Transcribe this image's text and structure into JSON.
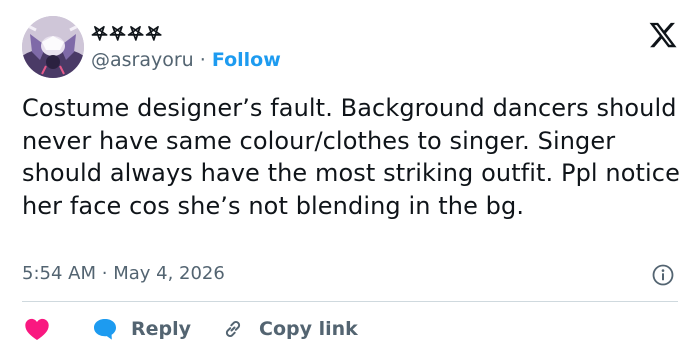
{
  "user": {
    "display_name": "𖤐𖤐𖤐𖤐",
    "handle": "@asrayoru",
    "separator": "·",
    "follow_label": "Follow"
  },
  "tweet": {
    "text": "Costume designer’s fault. Background dancers should never have same colour/clothes to singer. Singer should always have the most striking outfit. Ppl notice her face cos she’s not blending in the bg.",
    "time": "5:54 AM",
    "separator": "·",
    "date": "May 4, 2026"
  },
  "actions": {
    "reply_label": "Reply",
    "copy_link_label": "Copy link"
  },
  "colors": {
    "accent": "#1d9bf0",
    "like": "#f91880",
    "secondary_text": "#536471",
    "divider": "#cfd9de"
  },
  "icons": {
    "brand": "x-logo-icon",
    "info": "info-icon",
    "like": "heart-icon",
    "reply": "reply-bubble-icon",
    "copy": "link-icon"
  }
}
